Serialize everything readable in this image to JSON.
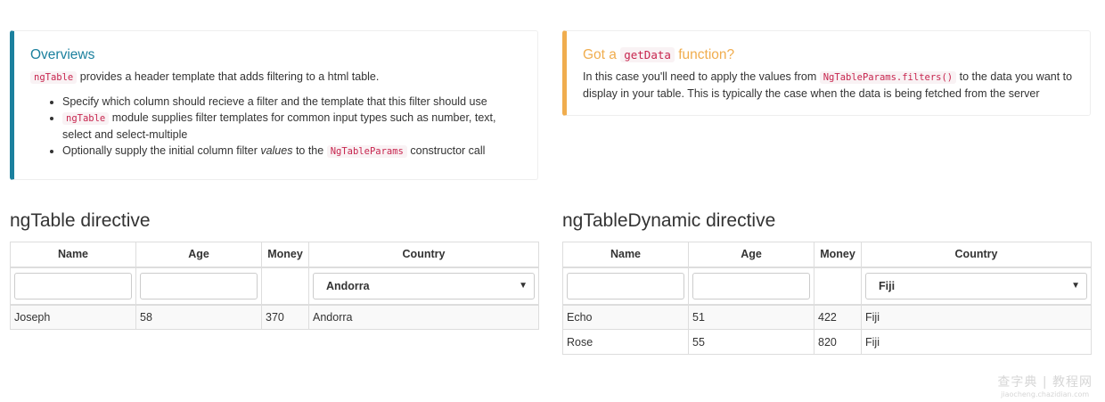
{
  "overviews": {
    "title": "Overviews",
    "intro_code": "ngTable",
    "intro_text": " provides a header template that adds filtering to a html table.",
    "bullet1": "Specify which column should recieve a filter and the template that this filter should use",
    "bullet2_code": "ngTable",
    "bullet2_text": " module supplies filter templates for common input types such as number, text, select and select-multiple",
    "bullet3_pre": "Optionally supply the initial column filter ",
    "bullet3_em": "values",
    "bullet3_mid": " to the ",
    "bullet3_code": "NgTableParams",
    "bullet3_post": " constructor call"
  },
  "getdata": {
    "title_pre": "Got a ",
    "title_code": "getData",
    "title_post": " function?",
    "text_pre": "In this case you'll need to apply the values from ",
    "text_code": "NgTableParams.filters()",
    "text_post": " to the data you want to display in your table. This is typically the case when the data is being fetched from the server"
  },
  "left_table": {
    "title": "ngTable directive",
    "headers": [
      "Name",
      "Age",
      "Money",
      "Country"
    ],
    "country_filter": "Andorra",
    "rows": [
      [
        "Joseph",
        "58",
        "370",
        "Andorra"
      ]
    ]
  },
  "right_table": {
    "title": "ngTableDynamic directive",
    "headers": [
      "Name",
      "Age",
      "Money",
      "Country"
    ],
    "country_filter": "Fiji",
    "rows": [
      [
        "Echo",
        "51",
        "422",
        "Fiji"
      ],
      [
        "Rose",
        "55",
        "820",
        "Fiji"
      ]
    ]
  },
  "watermark": {
    "main": "查字典 | 教程网",
    "sub": "jiaocheng.chazidian.com"
  }
}
